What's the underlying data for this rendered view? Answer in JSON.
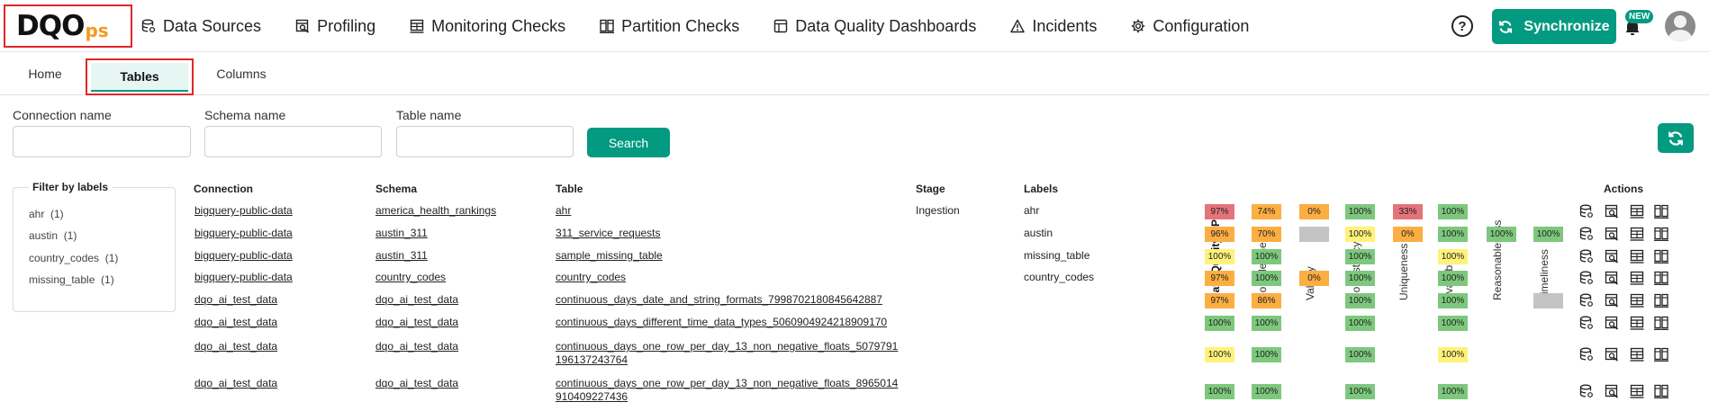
{
  "logo": {
    "text": "DQO",
    "suffix": "ps"
  },
  "nav": [
    {
      "label": "Data Sources",
      "icon": "database-icon"
    },
    {
      "label": "Profiling",
      "icon": "profiling-icon"
    },
    {
      "label": "Monitoring Checks",
      "icon": "monitoring-icon"
    },
    {
      "label": "Partition Checks",
      "icon": "partition-icon"
    },
    {
      "label": "Data Quality Dashboards",
      "icon": "dashboard-icon"
    },
    {
      "label": "Incidents",
      "icon": "warning-icon"
    },
    {
      "label": "Configuration",
      "icon": "gear-icon"
    }
  ],
  "header": {
    "help": "?",
    "sync_label": "Synchronize",
    "new_badge": "NEW"
  },
  "tabs": [
    {
      "label": "Home"
    },
    {
      "label": "Tables"
    },
    {
      "label": "Columns"
    }
  ],
  "filters": {
    "connection_label": "Connection name",
    "schema_label": "Schema name",
    "table_label": "Table name",
    "search_label": "Search"
  },
  "labels_filter": {
    "title": "Filter by labels",
    "items": [
      {
        "label": "ahr",
        "count": "(1)"
      },
      {
        "label": "austin",
        "count": "(1)"
      },
      {
        "label": "country_codes",
        "count": "(1)"
      },
      {
        "label": "missing_table",
        "count": "(1)"
      }
    ]
  },
  "table": {
    "headers": {
      "connection": "Connection",
      "schema": "Schema",
      "table": "Table",
      "stage": "Stage",
      "labels": "Labels",
      "actions": "Actions"
    },
    "dimensions": [
      "Data Quality KPI",
      "Completeness",
      "Validity",
      "Consistency",
      "Uniqueness",
      "Availability",
      "Reasonableness",
      "Timeliness"
    ],
    "colors": {
      "red": "#e5737a",
      "orange": "#fcae42",
      "green": "#7dc87d",
      "yellow": "#fff27a",
      "gray": "#c4c4c4"
    },
    "rows": [
      {
        "connection": "bigquery-public-data",
        "schema": "america_health_rankings",
        "table": [
          "ahr"
        ],
        "stage": "Ingestion",
        "label": "ahr",
        "cells": [
          {
            "v": "97%",
            "c": "red"
          },
          {
            "v": "74%",
            "c": "orange"
          },
          {
            "v": "0%",
            "c": "orange"
          },
          {
            "v": "100%",
            "c": "green"
          },
          {
            "v": "33%",
            "c": "red"
          },
          {
            "v": "100%",
            "c": "green"
          },
          null,
          null
        ]
      },
      {
        "connection": "bigquery-public-data",
        "schema": "austin_311",
        "table": [
          "311_service_requests"
        ],
        "stage": "",
        "label": "austin",
        "cells": [
          {
            "v": "96%",
            "c": "orange"
          },
          {
            "v": "70%",
            "c": "orange"
          },
          {
            "v": "",
            "c": "gray"
          },
          {
            "v": "100%",
            "c": "yellow"
          },
          {
            "v": "0%",
            "c": "orange"
          },
          {
            "v": "100%",
            "c": "green"
          },
          {
            "v": "100%",
            "c": "green"
          },
          {
            "v": "100%",
            "c": "green"
          }
        ]
      },
      {
        "connection": "bigquery-public-data",
        "schema": "austin_311",
        "table": [
          "sample_missing_table"
        ],
        "stage": "",
        "label": "missing_table",
        "cells": [
          {
            "v": "100%",
            "c": "yellow"
          },
          {
            "v": "100%",
            "c": "green"
          },
          null,
          {
            "v": "100%",
            "c": "green"
          },
          null,
          {
            "v": "100%",
            "c": "yellow"
          },
          null,
          null
        ]
      },
      {
        "connection": "bigquery-public-data",
        "schema": "country_codes",
        "table": [
          "country_codes"
        ],
        "stage": "",
        "label": "country_codes",
        "cells": [
          {
            "v": "97%",
            "c": "orange"
          },
          {
            "v": "100%",
            "c": "green"
          },
          {
            "v": "0%",
            "c": "orange"
          },
          {
            "v": "100%",
            "c": "green"
          },
          null,
          {
            "v": "100%",
            "c": "green"
          },
          null,
          null
        ]
      },
      {
        "connection": "dqo_ai_test_data",
        "schema": "dqo_ai_test_data",
        "table": [
          "continuous_days_date_and_string_formats_7998702180845642887"
        ],
        "stage": "",
        "label": "",
        "cells": [
          {
            "v": "97%",
            "c": "orange"
          },
          {
            "v": "86%",
            "c": "orange"
          },
          null,
          {
            "v": "100%",
            "c": "green"
          },
          null,
          {
            "v": "100%",
            "c": "green"
          },
          null,
          {
            "v": "",
            "c": "gray"
          }
        ]
      },
      {
        "connection": "dqo_ai_test_data",
        "schema": "dqo_ai_test_data",
        "table": [
          "continuous_days_different_time_data_types_5060904924218909170"
        ],
        "stage": "",
        "label": "",
        "cells": [
          {
            "v": "100%",
            "c": "green"
          },
          {
            "v": "100%",
            "c": "green"
          },
          null,
          {
            "v": "100%",
            "c": "green"
          },
          null,
          {
            "v": "100%",
            "c": "green"
          },
          null,
          null
        ]
      },
      {
        "connection": "dqo_ai_test_data",
        "schema": "dqo_ai_test_data",
        "table": [
          "continuous_days_one_row_per_day_13_non_negative_floats_5079791",
          "196137243764"
        ],
        "stage": "",
        "label": "",
        "cells": [
          {
            "v": "100%",
            "c": "yellow"
          },
          {
            "v": "100%",
            "c": "green"
          },
          null,
          {
            "v": "100%",
            "c": "green"
          },
          null,
          {
            "v": "100%",
            "c": "yellow"
          },
          null,
          null
        ]
      },
      {
        "connection": "dqo_ai_test_data",
        "schema": "dqo_ai_test_data",
        "table": [
          "continuous_days_one_row_per_day_13_non_negative_floats_8965014",
          "910409227436"
        ],
        "stage": "",
        "label": "",
        "cells": [
          {
            "v": "100%",
            "c": "green"
          },
          {
            "v": "100%",
            "c": "green"
          },
          null,
          {
            "v": "100%",
            "c": "green"
          },
          null,
          {
            "v": "100%",
            "c": "green"
          },
          null,
          null
        ]
      }
    ]
  }
}
